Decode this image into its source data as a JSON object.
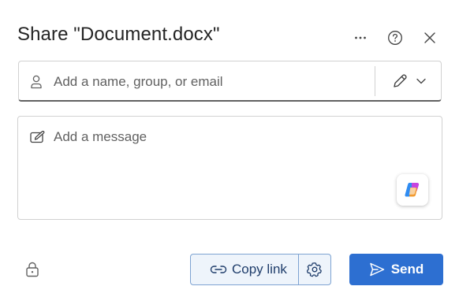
{
  "dialog": {
    "title": "Share \"Document.docx\"",
    "more_icon": "more-horizontal-icon",
    "help_icon": "help-circle-icon",
    "close_icon": "close-icon"
  },
  "people_field": {
    "placeholder": "Add a name, group, or email",
    "icon": "person-icon",
    "permission_icon": "pencil-edit-icon",
    "dropdown_icon": "chevron-down-icon"
  },
  "message_field": {
    "placeholder": "Add a message",
    "icon": "compose-icon",
    "copilot_icon": "copilot-icon"
  },
  "footer": {
    "lock_icon": "lock-icon",
    "copy_link_label": "Copy link",
    "copy_link_icon": "link-icon",
    "settings_icon": "gear-icon",
    "send_label": "Send",
    "send_icon": "send-icon"
  },
  "colors": {
    "accent": "#2d6fd1",
    "copy_link_bg": "#eef4fb",
    "copy_link_border": "#7ea3d2"
  }
}
